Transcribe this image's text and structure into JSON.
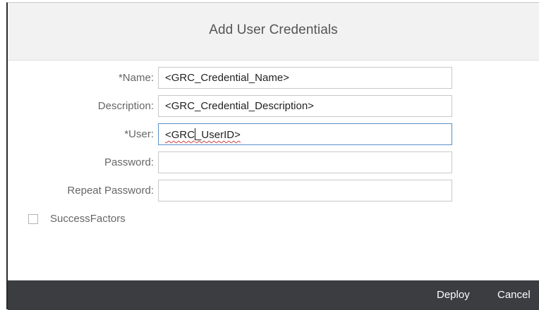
{
  "dialog": {
    "title": "Add User Credentials"
  },
  "form": {
    "name": {
      "label": "*Name:",
      "value": "<GRC_Credential_Name>"
    },
    "description": {
      "label": "Description:",
      "value": "<GRC_Credential_Description>"
    },
    "user": {
      "label": "*User:",
      "value_before_caret": "<GRC",
      "value_after_caret": "_UserID>"
    },
    "password": {
      "label": "Password:",
      "value": ""
    },
    "repeat_password": {
      "label": "Repeat Password:",
      "value": ""
    },
    "successfactors": {
      "label": "SuccessFactors",
      "checked": false
    }
  },
  "footer": {
    "deploy_label": "Deploy",
    "cancel_label": "Cancel"
  },
  "colors": {
    "footer_bg": "#3b3d40",
    "header_bg": "#f2f2f2",
    "focus_border": "#5a8fc8"
  }
}
